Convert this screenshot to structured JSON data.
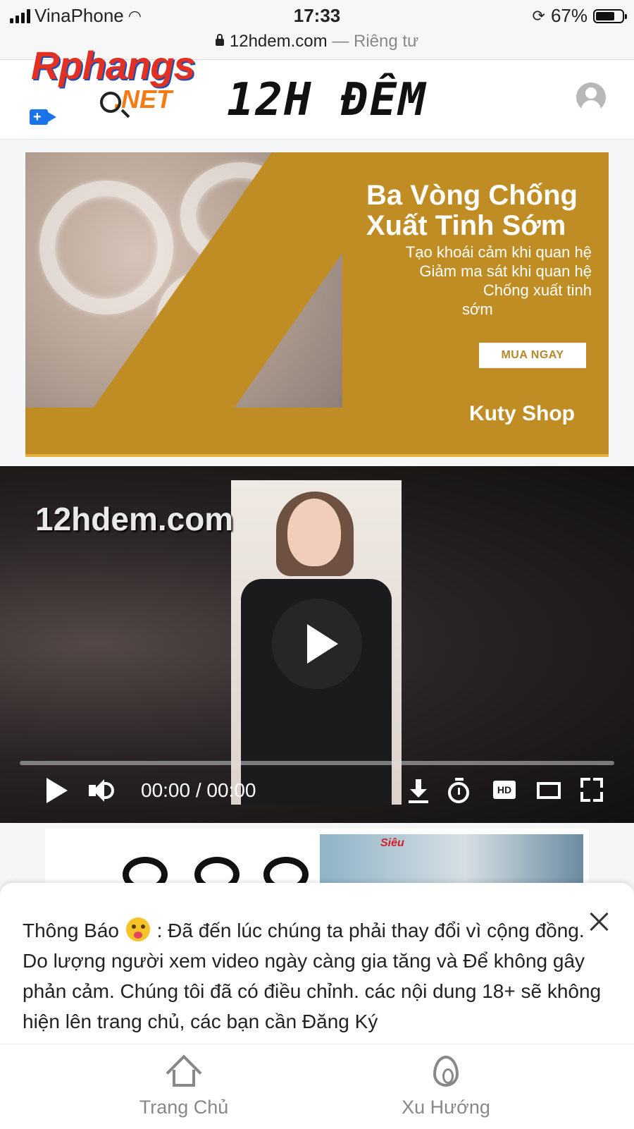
{
  "status": {
    "carrier": "VinaPhone",
    "time": "17:33",
    "battery": "67%"
  },
  "browser": {
    "domain": "12hdem.com",
    "suffix": "— Riêng tư"
  },
  "header": {
    "logo_main": "Rphangs",
    "logo_sub": ".NET",
    "site_title": "12H ĐÊM"
  },
  "ad": {
    "headline_1": "Ba Vòng Chống",
    "headline_2": "Xuất Tinh Sớm",
    "lines": [
      "Tạo khoái cảm khi quan hệ",
      "Giảm ma sát khi quan hệ",
      "Chống xuất tinh",
      "sớm"
    ],
    "button": "MUA NGAY",
    "shop": "Kuty Shop"
  },
  "video": {
    "watermark": "12hdem.com",
    "time": "00:00 / 00:00",
    "hd_label": "HD",
    "progress": 0
  },
  "ad2": {
    "tag": "Siêu"
  },
  "notice": {
    "label": "Thông Báo",
    "text": ": Đã đến lúc chúng ta phải thay đổi vì cộng đồng. Do lượng người xem video ngày càng gia tăng và Để không gây phản cảm. Chúng tôi đã có điều chỉnh. các nội dung 18+ sẽ không hiện lên trang chủ, các bạn cần Đăng Ký"
  },
  "nav": {
    "home": "Trang Chủ",
    "trending": "Xu Hướng"
  },
  "colors": {
    "ad_bg": "#bf8d23",
    "logo_red": "#e23023",
    "logo_orange": "#f47b14"
  }
}
